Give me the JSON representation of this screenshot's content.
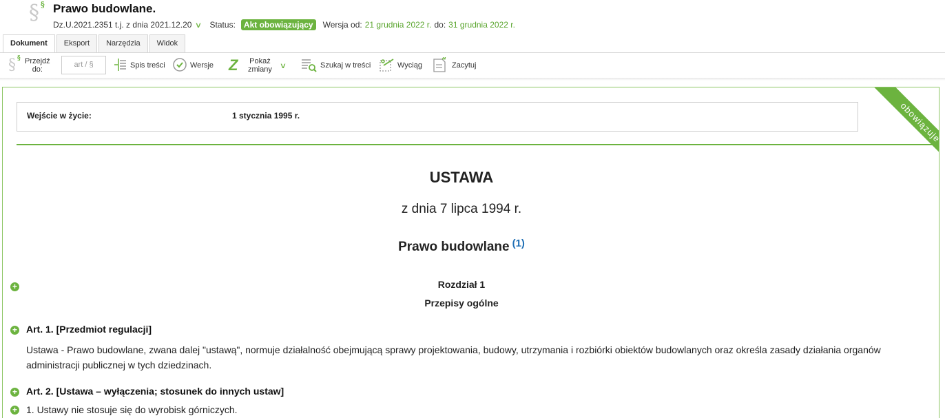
{
  "header": {
    "title": "Prawo budowlane.",
    "reference": "Dz.U.2021.2351 t.j. z dnia 2021.12.20",
    "status_label": "Status:",
    "status_badge": "Akt obowiązujący",
    "version_from_label": "Wersja od:",
    "version_from": "21 grudnia 2022 r.",
    "version_to_label": "do:",
    "version_to": "31 grudnia 2022 r."
  },
  "tabs": [
    "Dokument",
    "Eksport",
    "Narzędzia",
    "Widok"
  ],
  "toolbar": {
    "goto_label_1": "Przejdź",
    "goto_label_2": "do:",
    "goto_placeholder": "art / §",
    "toc": "Spis treści",
    "versions": "Wersje",
    "changes_1": "Pokaż",
    "changes_2": "zmiany",
    "search": "Szukaj w treści",
    "excerpt": "Wyciąg",
    "cite": "Zacytuj"
  },
  "content": {
    "entry_label": "Wejście w życie:",
    "entry_value": "1 stycznia 1995 r.",
    "ribbon": "obowiązuje",
    "act_type": "USTAWA",
    "act_date": "z dnia 7 lipca 1994 r.",
    "act_name": "Prawo budowlane",
    "footnote": "(1)",
    "chapter": "Rozdział  1",
    "chapter_name": "Przepisy ogólne",
    "art1_head": "Art.  1.   [Przedmiot regulacji]",
    "art1_body": "Ustawa - Prawo budowlane, zwana dalej \"ustawą\", normuje działalność obejmującą sprawy projektowania, budowy, utrzymania i rozbiórki obiektów budowlanych oraz określa zasady działania organów administracji publicznej w tych dziedzinach.",
    "art2_head": "Art.  2.   [Ustawa – wyłączenia; stosunek do innych ustaw]",
    "art2_p1": "1.   Ustawy nie stosuje się do wyrobisk górniczych."
  },
  "colors": {
    "accent": "#6cb33f",
    "footnote": "#1f6fb5"
  }
}
